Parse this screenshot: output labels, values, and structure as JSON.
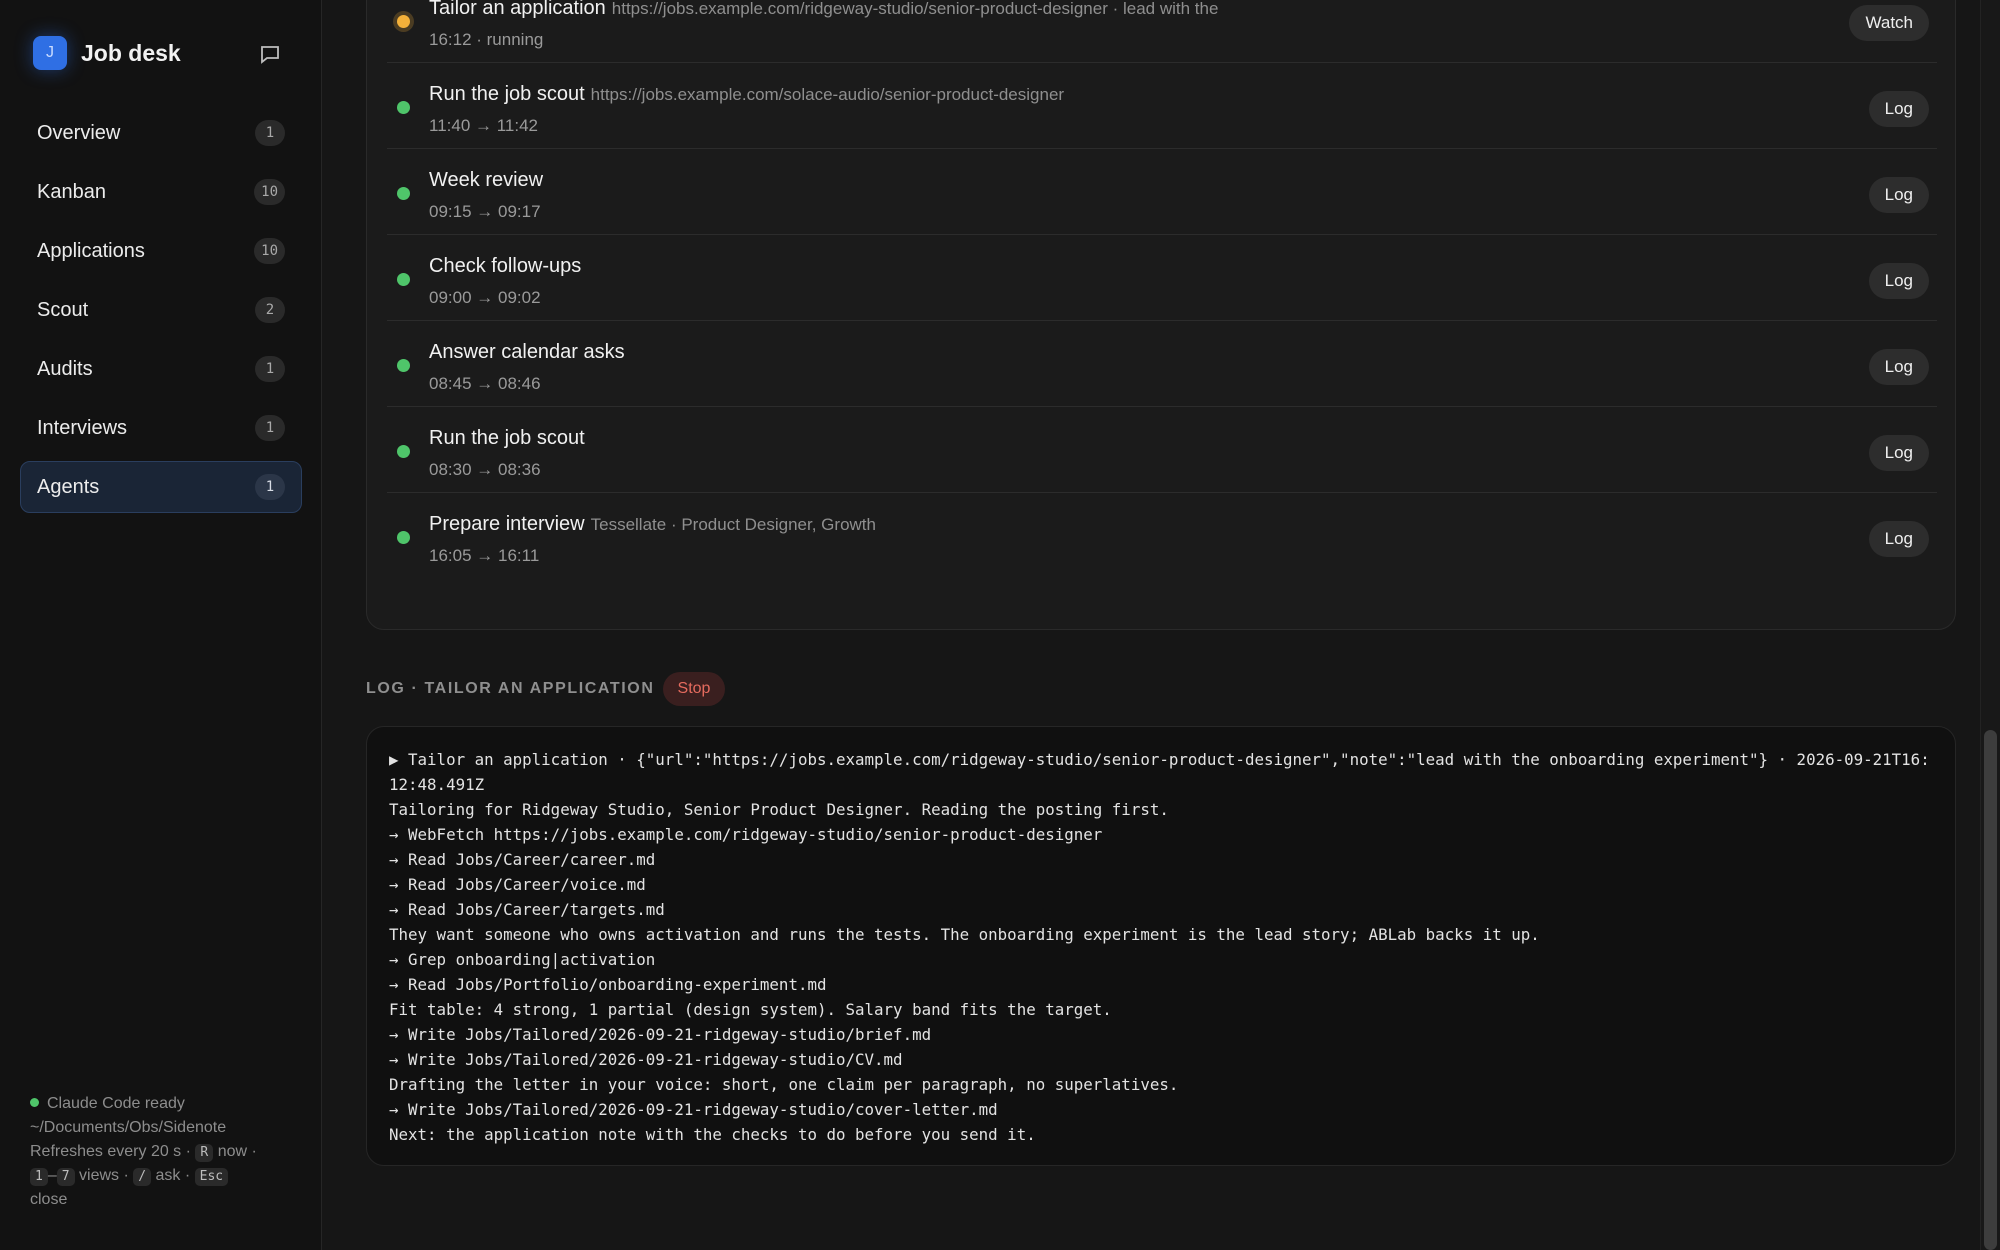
{
  "brand": {
    "logo_letter": "J",
    "title": "Job desk"
  },
  "nav": [
    {
      "label": "Overview",
      "count": "1"
    },
    {
      "label": "Kanban",
      "count": "10"
    },
    {
      "label": "Applications",
      "count": "10"
    },
    {
      "label": "Scout",
      "count": "2"
    },
    {
      "label": "Audits",
      "count": "1"
    },
    {
      "label": "Interviews",
      "count": "1"
    },
    {
      "label": "Agents",
      "count": "1",
      "active": true
    }
  ],
  "status": {
    "ready": "Claude Code ready",
    "path": "~/Documents/Obs/Sidenote",
    "refresh": "Refreshes every 20 s ·",
    "key_r": "R",
    "now": "now ·",
    "key_1": "1",
    "dash": "–",
    "key_7": "7",
    "views": "views ·",
    "key_slash": "/",
    "ask": "ask ·",
    "key_esc": "Esc",
    "close": "close",
    "color": "#4fc56a"
  },
  "runs": [
    {
      "title": "Tailor an application",
      "detail": "https://jobs.example.com/ridgeway-studio/senior-product-designer · lead with the",
      "time": "16:12 · running",
      "button": "Watch",
      "state": "running"
    },
    {
      "title": "Run the job scout",
      "detail": "https://jobs.example.com/solace-audio/senior-product-designer",
      "time": "11:40 → 11:42",
      "button": "Log",
      "state": "done"
    },
    {
      "title": "Week review",
      "detail": "",
      "time": "09:15 → 09:17",
      "button": "Log",
      "state": "done"
    },
    {
      "title": "Check follow-ups",
      "detail": "",
      "time": "09:00 → 09:02",
      "button": "Log",
      "state": "done"
    },
    {
      "title": "Answer calendar asks",
      "detail": "",
      "time": "08:45 → 08:46",
      "button": "Log",
      "state": "done"
    },
    {
      "title": "Run the job scout",
      "detail": "",
      "time": "08:30 → 08:36",
      "button": "Log",
      "state": "done"
    },
    {
      "title": "Prepare interview",
      "detail": "Tessellate · Product Designer, Growth",
      "time": "16:05 → 16:11",
      "button": "Log",
      "state": "done"
    }
  ],
  "log": {
    "heading": "LOG · TAILOR AN APPLICATION",
    "stop_label": "Stop",
    "lines": [
      "▶ Tailor an application · {\"url\":\"https://jobs.example.com/ridgeway-studio/senior-product-designer\",\"note\":\"lead with the onboarding experiment\"} · 2026-09-21T16:12:48.491Z",
      "Tailoring for Ridgeway Studio, Senior Product Designer. Reading the posting first.",
      "→ WebFetch https://jobs.example.com/ridgeway-studio/senior-product-designer",
      "→ Read Jobs/Career/career.md",
      "→ Read Jobs/Career/voice.md",
      "→ Read Jobs/Career/targets.md",
      "They want someone who owns activation and runs the tests. The onboarding experiment is the lead story; ABLab backs it up.",
      "→ Grep onboarding|activation",
      "→ Read Jobs/Portfolio/onboarding-experiment.md",
      "Fit table: 4 strong, 1 partial (design system). Salary band fits the target.",
      "→ Write Jobs/Tailored/2026-09-21-ridgeway-studio/brief.md",
      "→ Write Jobs/Tailored/2026-09-21-ridgeway-studio/CV.md",
      "Drafting the letter in your voice: short, one claim per paragraph, no superlatives.",
      "→ Write Jobs/Tailored/2026-09-21-ridgeway-studio/cover-letter.md",
      "Next: the application note with the checks to do before you send it."
    ]
  },
  "colors": {
    "accent": "#2f6fe4",
    "running": "#f4b13a",
    "done": "#4fc56a",
    "stop": "#e56b5e"
  }
}
